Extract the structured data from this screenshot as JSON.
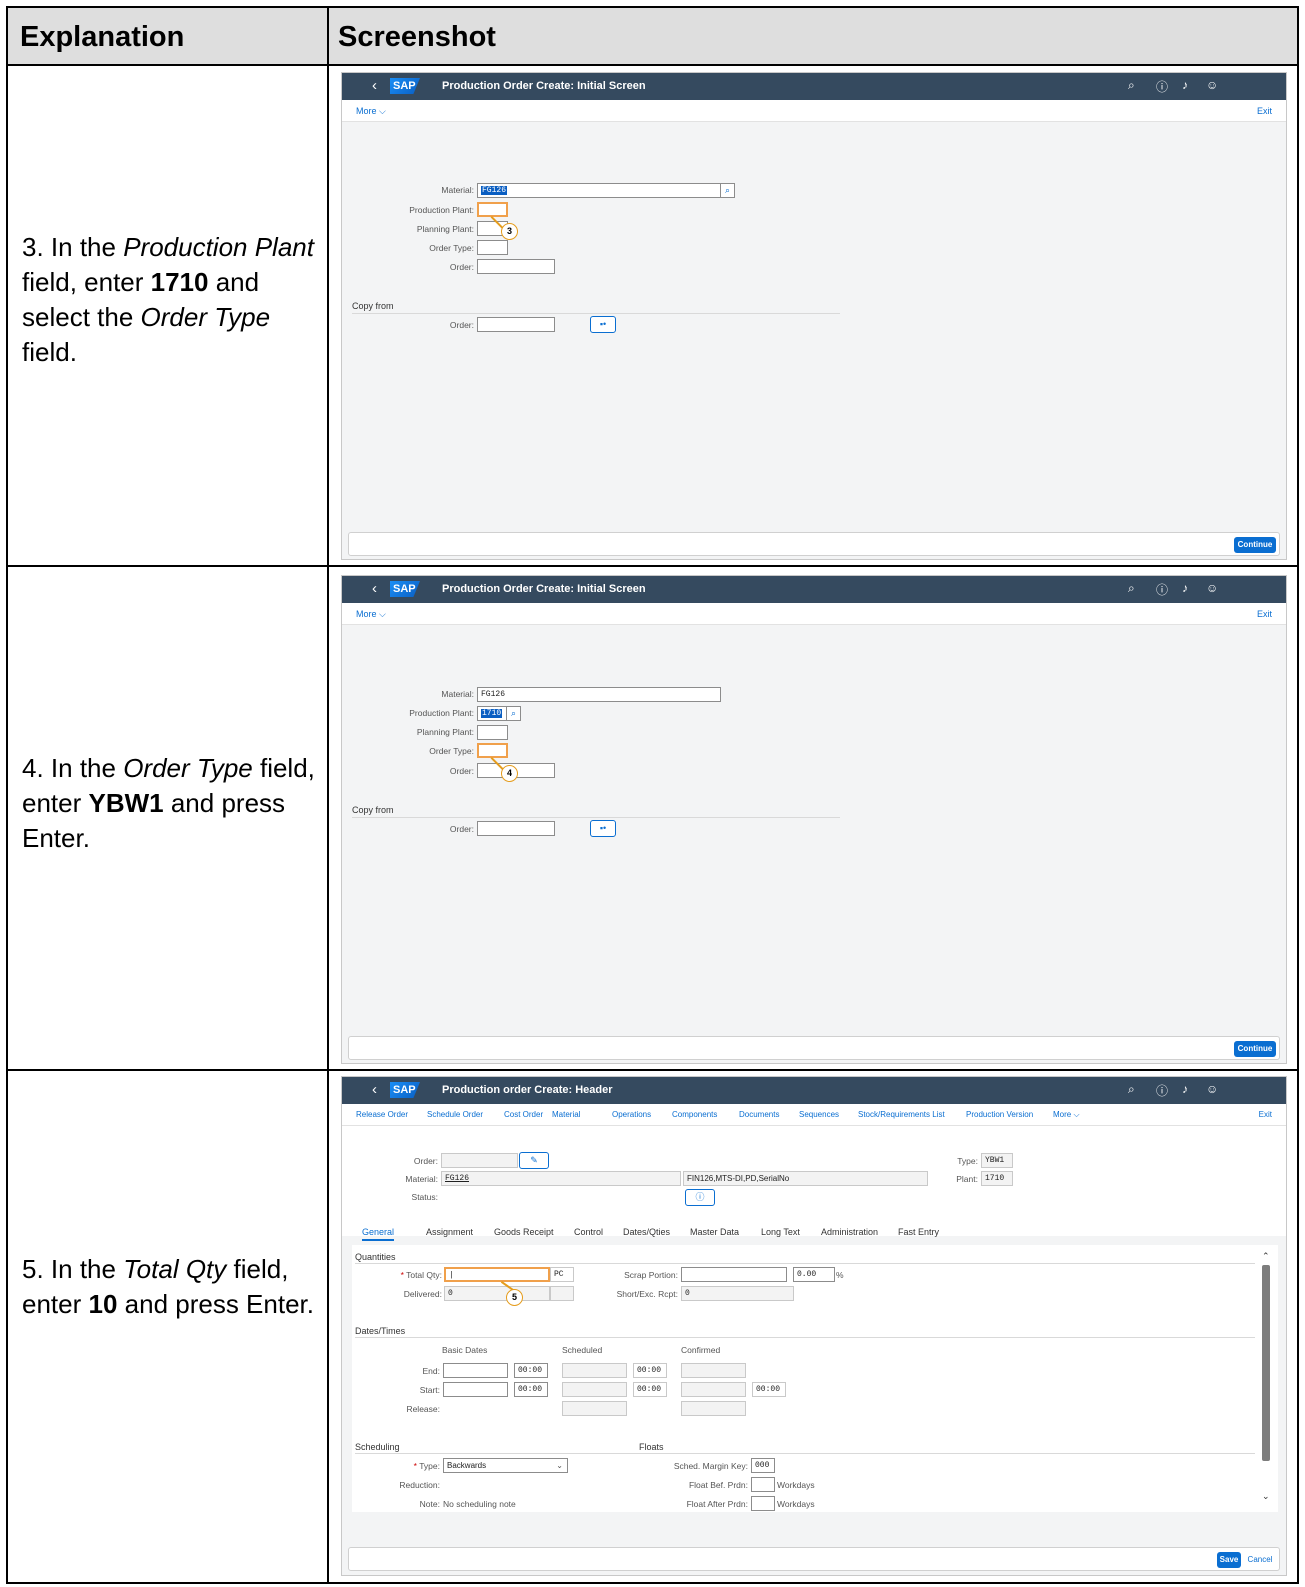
{
  "table": {
    "col1": "Explanation",
    "col2": "Screenshot"
  },
  "steps": [
    {
      "num": "3. In the ",
      "italic1": "Production Plant",
      "mid": " field, enter ",
      "bold": "1710",
      "mid2": " and select the ",
      "italic2": "Order Type",
      "end": " field."
    },
    {
      "num": "4. In the ",
      "italic1": "Order Type",
      "mid": " field, enter ",
      "bold": "YBW1",
      "end": " and press Enter."
    },
    {
      "num": "5. In the ",
      "italic1": "Total Qty",
      "mid": " field, enter ",
      "bold": "10",
      "end": " and press Enter."
    }
  ],
  "common": {
    "sap_logo": "SAP",
    "back": "‹",
    "more": "More ⌵",
    "exit": "Exit",
    "continue": "Continue",
    "shell_icons": [
      "search-icon",
      "help-icon",
      "bell-icon",
      "user-icon"
    ]
  },
  "screen1": {
    "title": "Production Order Create: Initial Screen",
    "labels": {
      "material": "Material:",
      "prod_plant": "Production Plant:",
      "plan_plant": "Planning Plant:",
      "order_type": "Order Type:",
      "order": "Order:",
      "copy_from": "Copy from",
      "copy_order": "Order:"
    },
    "values": {
      "material": "FG126",
      "prod_plant": ""
    },
    "callout": "3"
  },
  "screen2": {
    "title": "Production Order Create: Initial Screen",
    "values": {
      "material": "FG126",
      "prod_plant": "1710",
      "order_type": ""
    },
    "callout": "4"
  },
  "screen3": {
    "title": "Production order Create: Header",
    "menu": [
      "Release Order",
      "Schedule Order",
      "Cost Order",
      "Material",
      "Operations",
      "Components",
      "Documents",
      "Sequences",
      "Stock/Requirements List",
      "Production Version",
      "More ⌵"
    ],
    "header": {
      "order_label": "Order:",
      "material_label": "Material:",
      "material_value": "FG126",
      "material_desc": "FIN126,MTS-DI,PD,SerialNo",
      "status_label": "Status:",
      "type_label": "Type:",
      "type_value": "YBW1",
      "plant_label": "Plant:",
      "plant_value": "1710"
    },
    "tabs": [
      "General",
      "Assignment",
      "Goods Receipt",
      "Control",
      "Dates/Qties",
      "Master Data",
      "Long Text",
      "Administration",
      "Fast Entry"
    ],
    "quantities": {
      "title": "Quantities",
      "total_qty_label": "Total Qty:",
      "unit": "PC",
      "delivered_label": "Delivered:",
      "delivered_value": "0",
      "scrap_label": "Scrap Portion:",
      "scrap_pct": "0.00",
      "pct": "%",
      "short_label": "Short/Exc. Rcpt:",
      "short_value": "0"
    },
    "dates": {
      "title": "Dates/Times",
      "basic": "Basic Dates",
      "scheduled": "Scheduled",
      "confirmed": "Confirmed",
      "end": "End:",
      "start": "Start:",
      "release": "Release:",
      "time": "00:00"
    },
    "scheduling": {
      "title": "Scheduling",
      "type_label": "Type:",
      "type_value": "Backwards",
      "reduction": "Reduction:",
      "note_label": "Note:",
      "note_value": "No scheduling note"
    },
    "floats": {
      "title": "Floats",
      "margin_label": "Sched. Margin Key:",
      "margin_value": "000",
      "bef_label": "Float Bef. Prdn:",
      "after_label": "Float After Prdn:",
      "workdays": "Workdays"
    },
    "footer": {
      "save": "Save",
      "cancel": "Cancel"
    },
    "callout": "5"
  }
}
